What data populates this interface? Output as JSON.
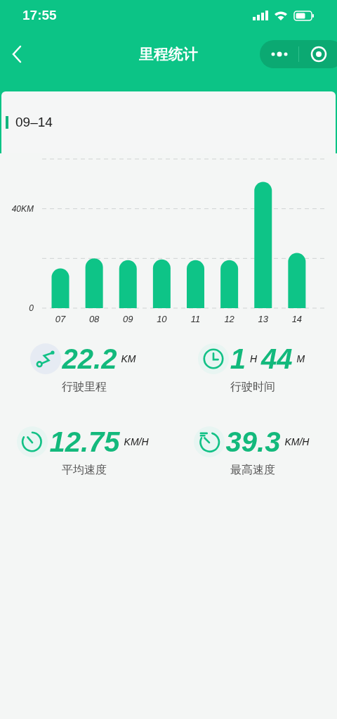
{
  "status_bar": {
    "time": "17:55"
  },
  "nav": {
    "title": "里程统计"
  },
  "range": {
    "label": "09–14"
  },
  "chart": {
    "chart_data": {
      "type": "bar",
      "categories": [
        "07",
        "08",
        "09",
        "10",
        "11",
        "12",
        "13",
        "14"
      ],
      "series": [
        {
          "color": "#0ec487",
          "values": [
            16,
            20,
            19.3,
            19.6,
            19.3,
            19.3,
            50.8,
            22.2
          ]
        }
      ],
      "ylim": [
        0,
        60
      ],
      "yticks": [
        {
          "value": 0,
          "label": "0"
        },
        {
          "value": 40,
          "label": "40KM"
        }
      ]
    }
  },
  "stats": [
    {
      "kind": "route",
      "label": "行驶里程",
      "parts": [
        {
          "kind": "value",
          "text": "22.2"
        },
        {
          "kind": "unit",
          "text": "KM"
        }
      ]
    },
    {
      "kind": "clock",
      "label": "行驶时间",
      "parts": [
        {
          "kind": "value",
          "text": "1"
        },
        {
          "kind": "unit",
          "text": "H"
        },
        {
          "kind": "value",
          "text": "44"
        },
        {
          "kind": "unit",
          "text": "M"
        }
      ]
    },
    {
      "kind": "timer",
      "label": "平均速度",
      "parts": [
        {
          "kind": "value",
          "text": "12.75"
        },
        {
          "kind": "unit",
          "text": "KM/H"
        }
      ]
    },
    {
      "kind": "fast",
      "label": "最高速度",
      "parts": [
        {
          "kind": "value",
          "text": "39.3"
        },
        {
          "kind": "unit",
          "text": "KM/H"
        }
      ]
    }
  ]
}
